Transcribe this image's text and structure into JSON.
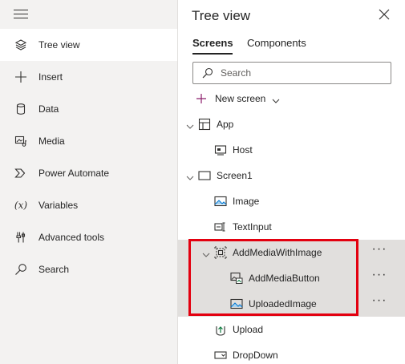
{
  "rail": {
    "items": [
      {
        "label": "Tree view",
        "icon": "layers-icon",
        "active": true
      },
      {
        "label": "Insert",
        "icon": "plus-icon"
      },
      {
        "label": "Data",
        "icon": "database-icon"
      },
      {
        "label": "Media",
        "icon": "media-icon"
      },
      {
        "label": "Power Automate",
        "icon": "power-automate-icon"
      },
      {
        "label": "Variables",
        "icon": "variables-icon",
        "glyph": "(x)"
      },
      {
        "label": "Advanced tools",
        "icon": "tools-icon"
      },
      {
        "label": "Search",
        "icon": "search-icon"
      }
    ]
  },
  "panel": {
    "title": "Tree view",
    "tabs": [
      {
        "label": "Screens",
        "active": true
      },
      {
        "label": "Components"
      }
    ],
    "search": {
      "placeholder": "Search",
      "value": ""
    },
    "new_screen_label": "New screen",
    "tree": [
      {
        "label": "App",
        "icon": "app-icon",
        "level": 0,
        "expanded": true
      },
      {
        "label": "Host",
        "icon": "host-icon",
        "level": 1
      },
      {
        "label": "Screen1",
        "icon": "screen-icon",
        "level": 0,
        "expanded": true
      },
      {
        "label": "Image",
        "icon": "image-icon",
        "level": 1
      },
      {
        "label": "TextInput",
        "icon": "text-input-icon",
        "level": 1
      },
      {
        "label": "AddMediaWithImage",
        "icon": "group-icon",
        "level": 1,
        "expanded": true,
        "selected": true,
        "more": "···"
      },
      {
        "label": "AddMediaButton",
        "icon": "add-media-icon",
        "level": 2,
        "selected": true,
        "more": "···"
      },
      {
        "label": "UploadedImage",
        "icon": "image-icon",
        "level": 2,
        "selected": true,
        "more": "···"
      },
      {
        "label": "Upload",
        "icon": "upload-icon",
        "level": 1
      },
      {
        "label": "DropDown",
        "icon": "dropdown-icon",
        "level": 1
      }
    ]
  },
  "colors": {
    "highlight": "#e3000f",
    "rail_bg": "#f3f2f1",
    "selected_bg": "#e1dfdd"
  }
}
